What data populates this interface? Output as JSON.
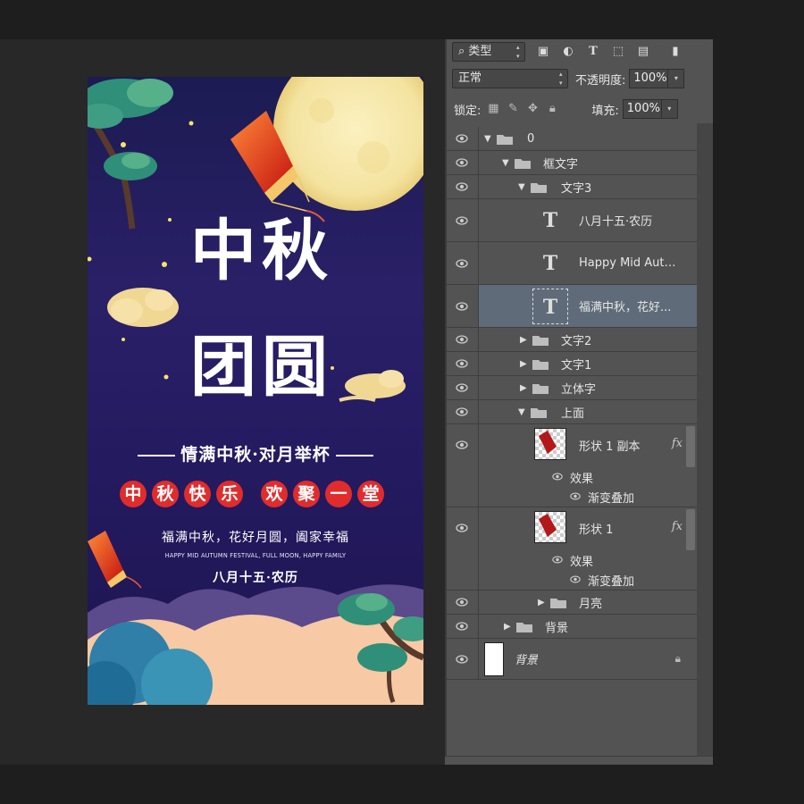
{
  "poster": {
    "title_line1": "中秋",
    "title_line2": "团圆",
    "tagline": "情满中秋·对月举杯",
    "chips_group1": [
      "中",
      "秋",
      "快",
      "乐"
    ],
    "chips_group2": [
      "欢",
      "聚",
      "一",
      "堂"
    ],
    "line_cn": "福满中秋，花好月圆，阖家幸福",
    "line_en": "HAPPY MID AUTUMN FESTIVAL, FULL MOON, HAPPY FAMILY",
    "line_date": "八月十五·农历"
  },
  "layers_panel": {
    "filter_type": "类型",
    "filter_icons": [
      "image-filter-icon",
      "adjustment-filter-icon",
      "text-filter-icon",
      "shape-filter-icon",
      "smart-object-filter-icon"
    ],
    "blend_mode": "正常",
    "opacity_label": "不透明度:",
    "opacity_value": "100%",
    "lock_label": "锁定:",
    "fill_label": "填充:",
    "fill_value": "100%",
    "layers": [
      {
        "name": "0",
        "kind": "group",
        "expanded": true
      },
      {
        "name": "框文字",
        "kind": "group",
        "expanded": true
      },
      {
        "name": "文字3",
        "kind": "group",
        "expanded": true
      },
      {
        "name": "八月十五·农历",
        "kind": "text"
      },
      {
        "name": "Happy Mid Autu...",
        "kind": "text"
      },
      {
        "name": "福满中秋，花好...",
        "kind": "text",
        "selected": true
      },
      {
        "name": "文字2",
        "kind": "group",
        "expanded": false
      },
      {
        "name": "文字1",
        "kind": "group",
        "expanded": false
      },
      {
        "name": "立体字",
        "kind": "group",
        "expanded": false
      },
      {
        "name": "上面",
        "kind": "group",
        "expanded": true
      },
      {
        "name": "形状 1 副本",
        "kind": "shape",
        "fx": "fx",
        "effects_label": "效果",
        "effect": "渐变叠加"
      },
      {
        "name": "形状 1",
        "kind": "shape",
        "fx": "fx",
        "effects_label": "效果",
        "effect": "渐变叠加"
      },
      {
        "name": "月亮",
        "kind": "group",
        "expanded": false
      },
      {
        "name": "背景",
        "kind": "group",
        "expanded": false
      },
      {
        "name": "背景",
        "kind": "background",
        "locked": true
      }
    ]
  },
  "colors": {
    "poster_bg": "#231c62",
    "moon": "#f6e7a6",
    "chip_red": "#e02c2c",
    "panel_bg": "#535353",
    "selected_row": "#5f6b78"
  }
}
